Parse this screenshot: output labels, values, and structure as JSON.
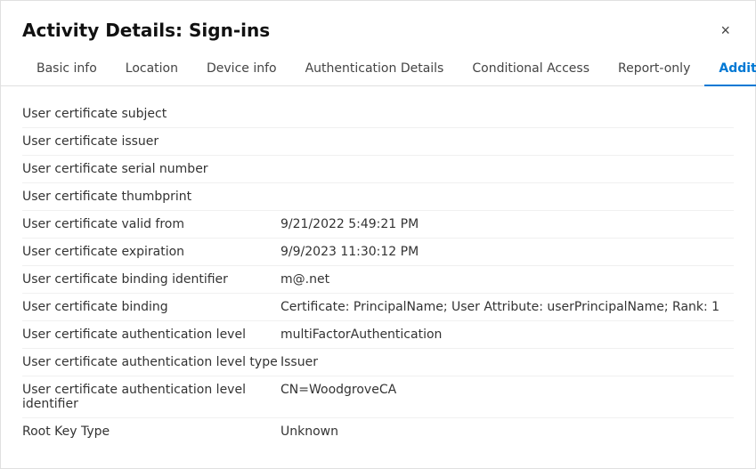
{
  "dialog": {
    "title": "Activity Details: Sign-ins"
  },
  "tabs": [
    {
      "id": "basic-info",
      "label": "Basic info",
      "active": false
    },
    {
      "id": "location",
      "label": "Location",
      "active": false
    },
    {
      "id": "device-info",
      "label": "Device info",
      "active": false
    },
    {
      "id": "authentication-details",
      "label": "Authentication Details",
      "active": false
    },
    {
      "id": "conditional-access",
      "label": "Conditional Access",
      "active": false
    },
    {
      "id": "report-only",
      "label": "Report-only",
      "active": false
    },
    {
      "id": "additional-details",
      "label": "Additional Details",
      "active": true
    }
  ],
  "rows": [
    {
      "label": "User certificate subject",
      "value": ""
    },
    {
      "label": "User certificate issuer",
      "value": ""
    },
    {
      "label": "User certificate serial number",
      "value": ""
    },
    {
      "label": "User certificate thumbprint",
      "value": ""
    },
    {
      "label": "User certificate valid from",
      "value": "9/21/2022 5:49:21 PM"
    },
    {
      "label": "User certificate expiration",
      "value": "9/9/2023 11:30:12 PM"
    },
    {
      "label": "User certificate binding identifier",
      "value": "m@.net"
    },
    {
      "label": "User certificate binding",
      "value": "Certificate: PrincipalName; User Attribute: userPrincipalName; Rank: 1"
    },
    {
      "label": "User certificate authentication level",
      "value": "multiFactorAuthentication"
    },
    {
      "label": "User certificate authentication level type",
      "value": "Issuer"
    },
    {
      "label": "User certificate authentication level identifier",
      "value": "CN=WoodgroveCA"
    },
    {
      "label": "Root Key Type",
      "value": "Unknown"
    }
  ],
  "close_label": "×"
}
